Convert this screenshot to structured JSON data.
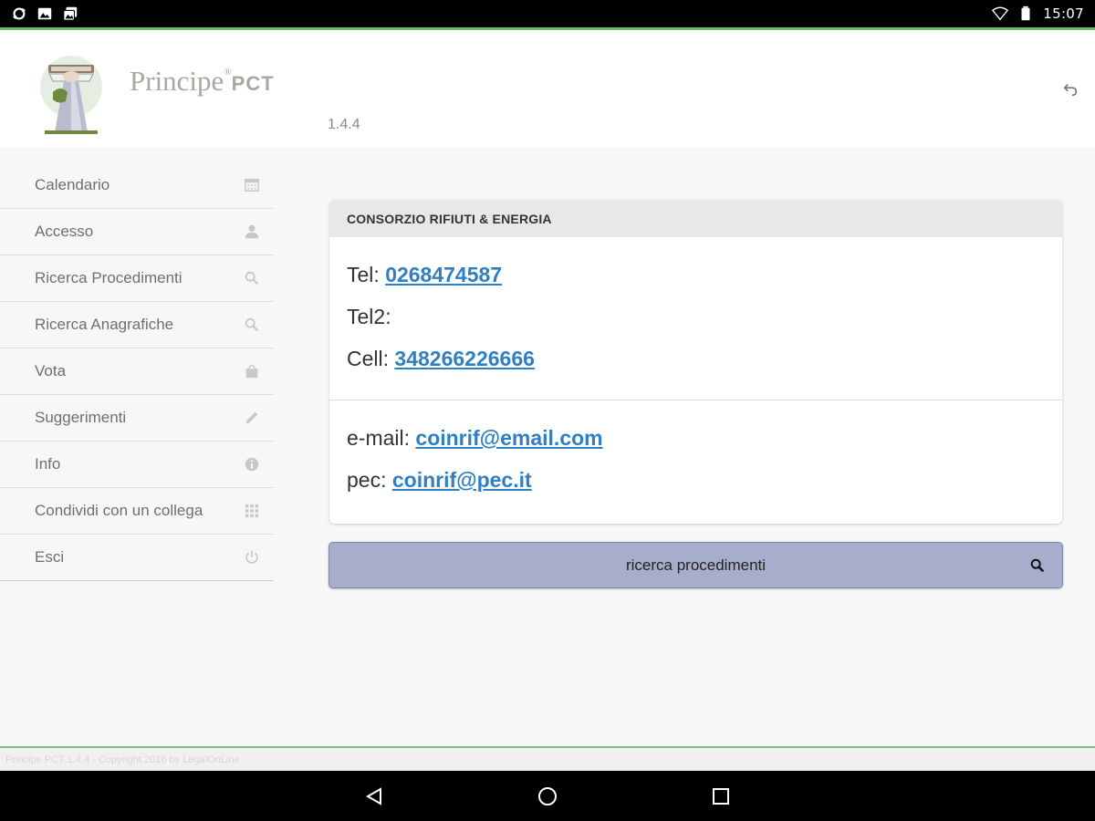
{
  "status_bar": {
    "time": "15:07",
    "left_icons": [
      "sync-icon",
      "image-icon",
      "gallery-icon"
    ],
    "right_icons": [
      "wifi-icon",
      "battery-icon"
    ]
  },
  "header": {
    "brand_name": "Principe",
    "brand_reg": "®",
    "brand_suffix": "PCT",
    "version": "1.4.4"
  },
  "sidebar": {
    "items": [
      {
        "label": "Calendario",
        "icon": "calendar-icon"
      },
      {
        "label": "Accesso",
        "icon": "user-icon"
      },
      {
        "label": "Ricerca Procedimenti",
        "icon": "search-icon"
      },
      {
        "label": "Ricerca Anagrafiche",
        "icon": "search-icon"
      },
      {
        "label": "Vota",
        "icon": "shopping-bag-icon"
      },
      {
        "label": "Suggerimenti",
        "icon": "pencil-icon"
      },
      {
        "label": "Info",
        "icon": "info-icon"
      },
      {
        "label": "Condividi con un collega",
        "icon": "grid-icon"
      },
      {
        "label": "Esci",
        "icon": "power-icon"
      }
    ]
  },
  "card": {
    "title": "CONSORZIO RIFIUTI & ENERGIA",
    "tel_label": "Tel:",
    "tel_value": "0268474587",
    "tel2_label": "Tel2:",
    "cell_label": "Cell:",
    "cell_value": "348266226666",
    "email_label": "e-mail:",
    "email_value": "coinrif@email.com",
    "pec_label": "pec:",
    "pec_value": "coinrif@pec.it"
  },
  "search_button": {
    "label": "ricerca procedimenti"
  },
  "footer": {
    "text": "Principe PCT 1.4.4 - Copyright 2016 by LegalOnLine"
  },
  "colors": {
    "accent_green": "#6bbf6a",
    "link_blue": "#2f7fc4",
    "button_bg": "#a6aecb"
  }
}
